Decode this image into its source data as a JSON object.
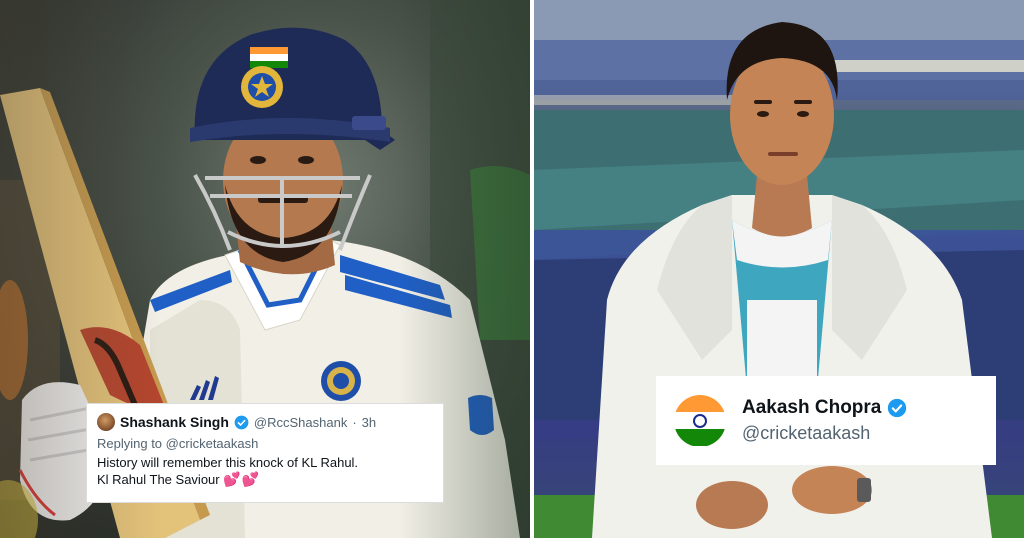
{
  "tweet": {
    "name": "Shashank Singh",
    "handle": "@RccShashank",
    "separator": "·",
    "age": "3h",
    "reply_prefix": "Replying to",
    "reply_to": "@cricketaakash",
    "line1": "History will remember this knock of KL Rahul.",
    "line2": "Kl Rahul The Saviour",
    "hearts": "💕💕",
    "verified": true
  },
  "profile": {
    "name": "Aakash Chopra",
    "handle": "@cricketaakash",
    "verified": true
  },
  "colors": {
    "verified_blue": "#1d9bf0",
    "saffron": "#ff9933",
    "green": "#138808",
    "navy": "#1a2b8e",
    "helmet_navy": "#1f2b57"
  }
}
